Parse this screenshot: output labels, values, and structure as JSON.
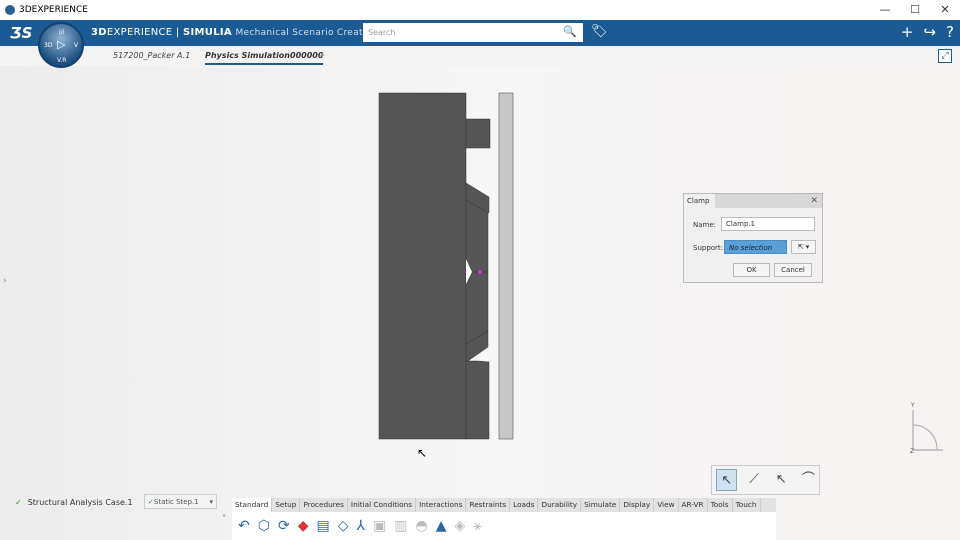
{
  "window": {
    "title": "3DEXPERIENCE",
    "controls": [
      "—",
      "☐",
      "✕"
    ]
  },
  "header": {
    "logo": "3DS",
    "brand_bold_prefix": "3D",
    "brand_rest": "EXPERIENCE | ",
    "brand_app": "SIMULIA",
    "subtitle": "Mechanical Scenario Creation",
    "search_placeholder": "Search",
    "compass": {
      "top": "i/i",
      "left": "3D",
      "right": "V",
      "bottom": "V.R"
    }
  },
  "tabs": [
    {
      "label": "517200_Packer A.1"
    },
    {
      "label": "Physics Simulation000000"
    }
  ],
  "add_tab": "+",
  "dialog": {
    "title": "Clamp",
    "name_label": "Name:",
    "name_value": "Clamp.1",
    "support_label": "Support:",
    "support_value": "No selection",
    "ok": "OK",
    "cancel": "Cancel"
  },
  "status": {
    "case": "Structural Analysis Case.1",
    "step": "Static Step.1"
  },
  "action_tabs": [
    "Standard",
    "Setup",
    "Procedures",
    "Initial Conditions",
    "Interactions",
    "Restraints",
    "Loads",
    "Durability",
    "Simulate",
    "Display",
    "View",
    "AR-VR",
    "Tools",
    "Touch"
  ],
  "active_action_tab": "Standard",
  "axis": {
    "y": "Y",
    "z": "Z"
  },
  "colors": {
    "brand": "#1b5a92",
    "part": "#555555",
    "plate": "#c8c8c8",
    "highlight": "#cc33cc"
  }
}
